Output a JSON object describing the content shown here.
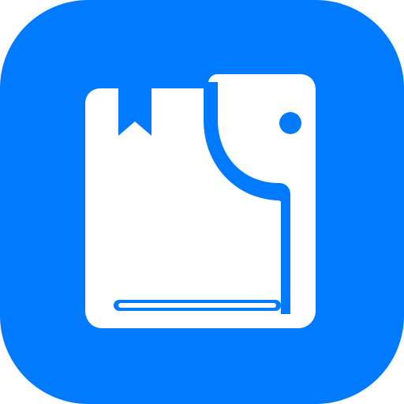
{
  "icon": {
    "name": "book-with-elephant-app-icon",
    "tile_color": "#007AFF",
    "glyph_color": "#FFFFFF"
  }
}
